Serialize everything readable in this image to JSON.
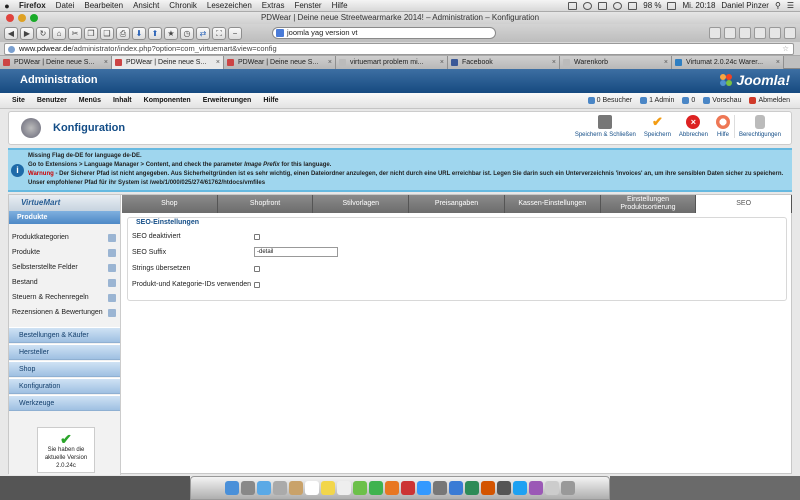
{
  "menubar": {
    "apple": "",
    "app": "Firefox",
    "items": [
      "Datei",
      "Bearbeiten",
      "Ansicht",
      "Chronik",
      "Lesezeichen",
      "Extras",
      "Fenster",
      "Hilfe"
    ],
    "battery": "98 %",
    "clock": "Mi. 20:18",
    "user": "Daniel Pinzer"
  },
  "window": {
    "title": "PDWear | Deine neue Streetwearmarke 2014! – Administration – Konfiguration",
    "search_value": "joomla yag version vt",
    "url_host": "www.pdwear.de",
    "url_path": "/administrator/index.php?option=com_virtuemart&view=config"
  },
  "browser_tabs": [
    {
      "label": "PDWear | Deine neue S...",
      "icon": "joomla-favicon"
    },
    {
      "label": "PDWear | Deine neue S...",
      "icon": "joomla-favicon",
      "active": true
    },
    {
      "label": "PDWear | Deine neue S...",
      "icon": "joomla-favicon"
    },
    {
      "label": "virtuemart problem mi...",
      "icon": "page-favicon"
    },
    {
      "label": "Facebook",
      "icon": "facebook-favicon"
    },
    {
      "label": "Warenkorb",
      "icon": "page-favicon"
    },
    {
      "label": "Virtumat 2.0.24c Warer...",
      "icon": "virtuemart-favicon"
    }
  ],
  "joomla": {
    "header_title": "Administration",
    "logo_text": "Joomla!",
    "menu": [
      "Site",
      "Benutzer",
      "Menüs",
      "Inhalt",
      "Komponenten",
      "Erweiterungen",
      "Hilfe"
    ],
    "status": [
      {
        "label": "0 Besucher",
        "color": "#4a86c6"
      },
      {
        "label": "1 Admin",
        "color": "#4a86c6"
      },
      {
        "label": "0",
        "color": "#4a86c6"
      },
      {
        "label": "Vorschau",
        "color": "#4a86c6"
      },
      {
        "label": "Abmelden",
        "color": "#d03a2a"
      }
    ],
    "page_title": "Konfiguration",
    "toolbar": {
      "save_close": "Speichern & Schließen",
      "save": "Speichern",
      "cancel": "Abbrechen",
      "help": "Hilfe",
      "permissions": "Berechtigungen"
    },
    "messages": {
      "line1": "Missing Flag de-DE for language de-DE.",
      "line2_pre": "Go to Extensions > Language Manager > Content, and check the parameter ",
      "line2_em": "Image Prefix",
      "line2_post": " for this language.",
      "warn_label": "Warnung",
      "warn_text": " - Der Sicherer Pfad ist nicht angegeben. Aus Sicherheitgründen ist es sehr wichtig, einen Dateiordner anzulegen, der nicht durch eine URL erreichbar ist. Legen Sie darin such ein Unterverzeichnis 'invoices' an, um ihre sensiblen Daten sicher zu speichern. Unser empfohlener Pfad für ihr System ist /web/1/000/025/274/61762/htdocs/vmfiles"
    }
  },
  "virtuemart": {
    "logo_text": "VirtueMart",
    "side_head": "Produkte",
    "side_links": [
      "Produktkategorien",
      "Produkte",
      "Selbsterstellte Felder",
      "Bestand",
      "Steuern & Rechenregeln",
      "Rezensionen & Bewertungen"
    ],
    "side_sections": [
      "Bestellungen & Käufer",
      "Hersteller",
      "Shop",
      "Konfiguration",
      "Werkzeuge"
    ],
    "version_box": {
      "line1": "Sie haben die",
      "line2": "aktuelle Version",
      "line3": "2.0.24c"
    },
    "tabs": [
      {
        "label": "Shop"
      },
      {
        "label": "Shopfront"
      },
      {
        "label": "Stilvorlagen"
      },
      {
        "label": "Preisangaben"
      },
      {
        "label": "Kassen-Einstellungen"
      },
      {
        "label_line1": "Einstellungen",
        "label_line2": "Produktsortierung"
      },
      {
        "label": "SEO",
        "active": true
      }
    ],
    "seo": {
      "legend": "SEO-Einstellungen",
      "fields": [
        {
          "label": "SEO deaktiviert",
          "type": "checkbox",
          "checked": false
        },
        {
          "label": "SEO Suffix",
          "type": "text",
          "value": "-detail"
        },
        {
          "label": "Strings übersetzen",
          "type": "checkbox",
          "checked": false
        },
        {
          "label": "Produkt-und Kategorie-IDs verwenden",
          "type": "checkbox",
          "checked": false
        }
      ]
    }
  }
}
